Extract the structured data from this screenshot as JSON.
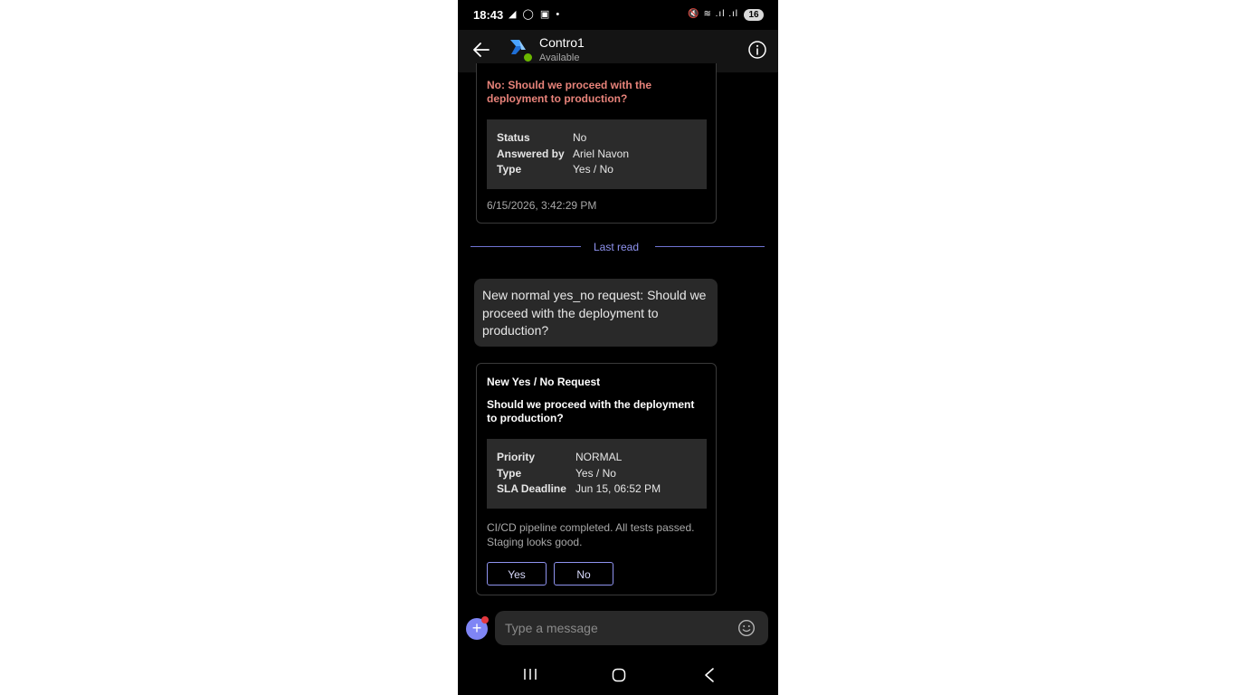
{
  "status_bar": {
    "time": "18:43",
    "left_icons": "◢ ◯ ▣ •",
    "right_icons": "🔇 ≋ .ıl .ıl",
    "battery": "16"
  },
  "header": {
    "name": "Contro1",
    "status": "Available",
    "presence_color": "#6bb700"
  },
  "messages": {
    "previous_card": {
      "title": "No: Should we proceed with the deployment to production?",
      "facts": [
        {
          "key": "Status",
          "value": "No"
        },
        {
          "key": "Answered by",
          "value": "Ariel Navon"
        },
        {
          "key": "Type",
          "value": "Yes / No"
        }
      ],
      "timestamp": "6/15/2026, 3:42:29 PM"
    },
    "divider_label": "Last read",
    "bubble_text": "New normal yes_no request: Should we proceed with the deployment to production?",
    "request_card": {
      "heading": "New Yes / No Request",
      "question": "Should we proceed with the deployment to production?",
      "facts": [
        {
          "key": "Priority",
          "value": "NORMAL"
        },
        {
          "key": "Type",
          "value": "Yes / No"
        },
        {
          "key": "SLA Deadline",
          "value": "Jun 15, 06:52 PM"
        }
      ],
      "description": "CI/CD pipeline completed. All tests passed. Staging looks good.",
      "yes_label": "Yes",
      "no_label": "No"
    }
  },
  "compose": {
    "placeholder": "Type a message",
    "plus_icon": "+"
  },
  "colors": {
    "accent": "#7f85f5",
    "declined_title": "#e8837a",
    "background": "#000000"
  },
  "icons": {
    "back": "arrow-left-icon",
    "info": "info-icon",
    "emoji": "emoji-icon",
    "attach": "plus-icon"
  }
}
